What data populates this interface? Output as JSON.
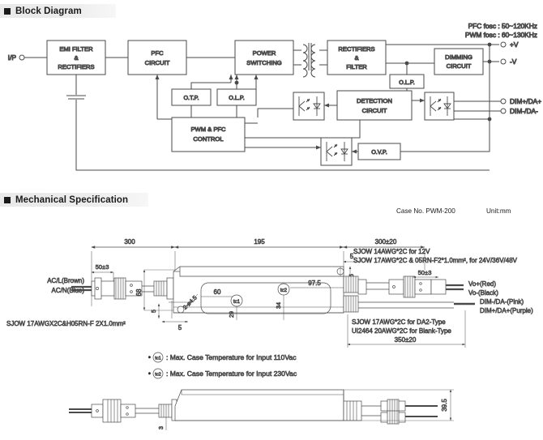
{
  "sections": {
    "block_diagram": {
      "title": "Block Diagram"
    },
    "mechanical": {
      "title": "Mechanical Specification"
    }
  },
  "block_diagram": {
    "freq_notes": [
      "PFC fosc : 50~120KHz",
      "PWM fosc : 60~130KHz"
    ],
    "input_label": "I/P",
    "blocks": [
      {
        "id": "emi",
        "lines": [
          "EMI FILTER",
          "&",
          "RECTIFIERS"
        ]
      },
      {
        "id": "pfc",
        "lines": [
          "PFC",
          "CIRCUIT"
        ]
      },
      {
        "id": "power_sw",
        "lines": [
          "POWER",
          "SWITCHING"
        ]
      },
      {
        "id": "rect_filt",
        "lines": [
          "RECTIFIERS",
          "&",
          "FILTER"
        ]
      },
      {
        "id": "dimming",
        "lines": [
          "DIMMING",
          "CIRCUIT"
        ]
      },
      {
        "id": "otp",
        "lines": [
          "O.T.P."
        ]
      },
      {
        "id": "olp1",
        "lines": [
          "O.L.P."
        ]
      },
      {
        "id": "olp2",
        "lines": [
          "O.L.P."
        ]
      },
      {
        "id": "pwm_pfc",
        "lines": [
          "PWM & PFC",
          "CONTROL"
        ]
      },
      {
        "id": "detection",
        "lines": [
          "DETECTION",
          "CIRCUIT"
        ]
      },
      {
        "id": "ovp",
        "lines": [
          "O.V.P."
        ]
      }
    ],
    "outputs": [
      {
        "label": "+V"
      },
      {
        "label": "-V"
      },
      {
        "label": "DIM+/DA+"
      },
      {
        "label": "DIM-/DA-"
      }
    ]
  },
  "mechanical": {
    "case_no": "Case No. PWM-200",
    "unit": "Unit:mm",
    "dimensions": {
      "input_cable_len": "300",
      "body_len": "195",
      "output_cable_len": "300±20",
      "connector_a": "50±3",
      "connector_b": "50±3",
      "dim_cable_len": "350±20",
      "body_width": "68",
      "body_height": "39.5",
      "screw_offset": "5",
      "screw_offset2": "5",
      "screw_offset3": "5",
      "screw_offset4": "5",
      "mount_hole_pitch": "60",
      "mount_hole_pitch2": "97.5",
      "mount_dim_34": "34",
      "mount_dim_29": "29",
      "hole_spec": "2-ø4.5",
      "edge_3": "3",
      "small_5": "5"
    },
    "labels": {
      "ac_l": "AC/L(Brown)",
      "ac_n": "AC/N(Blue)",
      "input_wire_spec": "SJOW 17AWGX2C&H05RN-F 2X1.0mm²",
      "vo_plus": "Vo+(Red)",
      "vo_minus": "Vo-(Black)",
      "dim_minus": "DIM-/DA-(Pink)",
      "dim_plus": "DIM+/DA+(Purple)",
      "out_wire_spec_1": "SJOW 14AWG*2C for 12V",
      "out_wire_spec_2": "SJOW 17AWG*2C & 05RN-F2*1.0mm², for 24V/36V/48V",
      "dim_wire_spec_1": "SJOW 17AWG*2C for DA2-Type",
      "dim_wire_spec_2": "UI2464 20AWG*2C for Blank-Type"
    },
    "tc_marks": {
      "tc1": "tc1",
      "tc2": "tc2"
    },
    "footnotes": [
      ": Max. Case Temperature for Input 110Vac",
      ": Max. Case Temperature for Input 230Vac"
    ],
    "footnote_marks": [
      "tc1",
      "tc2"
    ]
  },
  "colors": {
    "line": "#4a4a4a",
    "text": "#1a1a1a",
    "header_bg": "#ebebeb"
  }
}
